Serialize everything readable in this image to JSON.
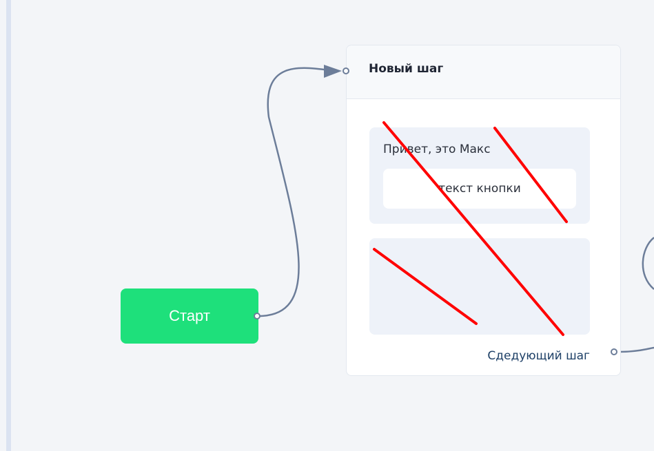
{
  "start_node": {
    "label": "Старт",
    "color": "#1ee07b"
  },
  "step": {
    "title": "Новый шаг",
    "message_text": "Привет, это Макс",
    "button_text": "текст кнопки",
    "next_step_label": "Сдедующий шаг"
  },
  "colors": {
    "canvas_bg": "#f3f5f8",
    "connector": "#6c7d99",
    "annotation_strike": "#ff0000"
  }
}
